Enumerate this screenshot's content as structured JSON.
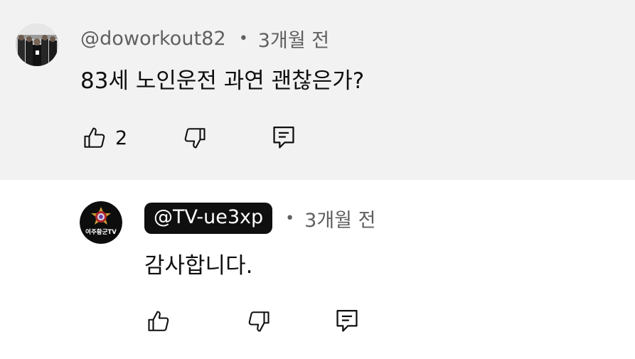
{
  "comments": [
    {
      "author": "@doworkout82",
      "time": "3개월 전",
      "separator": "•",
      "text": "83세 노인운전 과연 괜찮은가?",
      "like_count": "2",
      "icons": [
        "thumb-up-icon",
        "thumb-down-icon",
        "reply-icon"
      ]
    },
    {
      "author": "@TV-ue3xp",
      "time": "3개월 전",
      "separator": "•",
      "text": "감사합니다.",
      "avatar_label": "여주황군TV",
      "icons": [
        "thumb-up-icon",
        "thumb-down-icon",
        "reply-icon"
      ]
    }
  ],
  "colors": {
    "top_comment_background": "#f2f2f2",
    "reply_background": "#ffffff",
    "author_chip_background": "#0f0f0f",
    "meta_text": "#606060",
    "body_text": "#0f0f0f"
  }
}
